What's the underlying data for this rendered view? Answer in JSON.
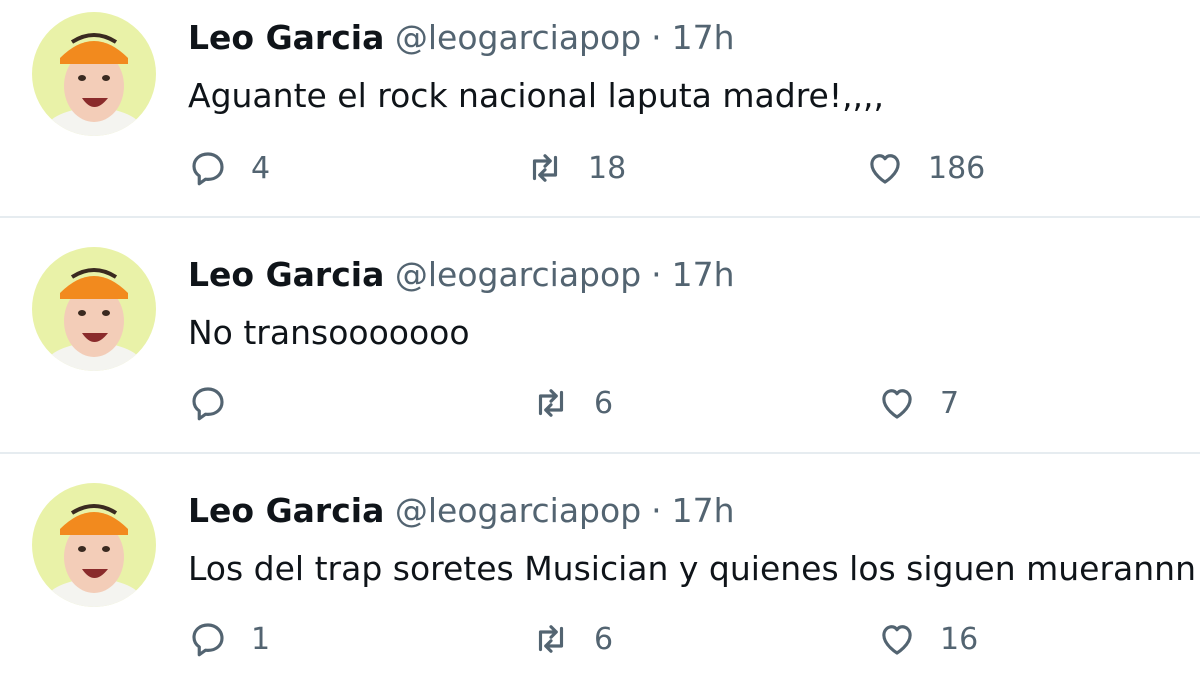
{
  "tweets": [
    {
      "name": "Leo Garcia",
      "handle": "@leogarciapop",
      "separator": "·",
      "time": "17h",
      "text": "Aguante el rock nacional laputa madre!,,,,",
      "replies": "4",
      "retweets": "18",
      "likes": "186"
    },
    {
      "name": "Leo Garcia",
      "handle": "@leogarciapop",
      "separator": "·",
      "time": "17h",
      "text": "No transooooooo",
      "replies": "",
      "retweets": "6",
      "likes": "7"
    },
    {
      "name": "Leo Garcia",
      "handle": "@leogarciapop",
      "separator": "·",
      "time": "17h",
      "text": "Los del trap soretes Musician y quienes los siguen muerannn",
      "replies": "1",
      "retweets": "6",
      "likes": "16"
    }
  ],
  "icons": {
    "reply": "speech-bubble-icon",
    "retweet": "retweet-arrows-icon",
    "like": "heart-icon"
  },
  "colors": {
    "text_primary": "#0f1419",
    "text_secondary": "#536471",
    "divider": "#e6ecf0",
    "avatar_background": "#e9f2a8",
    "cap": "#f28a1e"
  }
}
